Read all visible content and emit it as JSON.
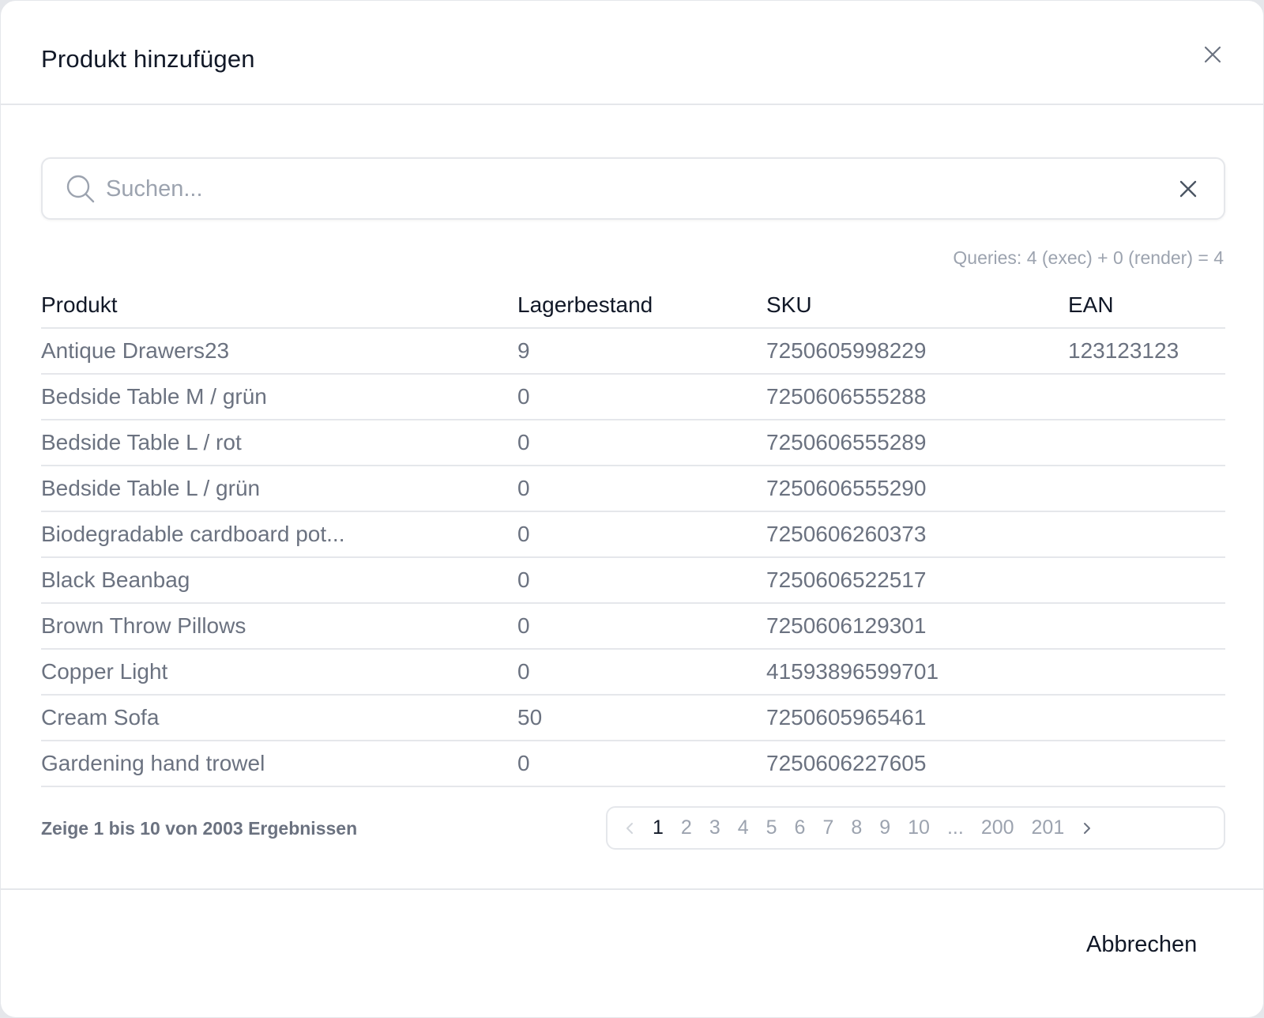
{
  "modal": {
    "title": "Produkt hinzufügen",
    "close_icon": "close-icon"
  },
  "search": {
    "placeholder": "Suchen...",
    "value": "",
    "icon": "search-icon",
    "clear_icon": "clear-icon"
  },
  "queries_text": "Queries: 4 (exec) + 0 (render) = 4",
  "table": {
    "headers": [
      "Produkt",
      "Lagerbestand",
      "SKU",
      "EAN"
    ],
    "rows": [
      {
        "product": "Antique Drawers23",
        "stock": "9",
        "sku": "7250605998229",
        "ean": "123123123"
      },
      {
        "product": "Bedside Table M / grün",
        "stock": "0",
        "sku": "7250606555288",
        "ean": ""
      },
      {
        "product": "Bedside Table L / rot",
        "stock": "0",
        "sku": "7250606555289",
        "ean": ""
      },
      {
        "product": "Bedside Table L / grün",
        "stock": "0",
        "sku": "7250606555290",
        "ean": ""
      },
      {
        "product": "Biodegradable cardboard pot...",
        "stock": "0",
        "sku": "7250606260373",
        "ean": ""
      },
      {
        "product": "Black Beanbag",
        "stock": "0",
        "sku": "7250606522517",
        "ean": ""
      },
      {
        "product": "Brown Throw Pillows",
        "stock": "0",
        "sku": "7250606129301",
        "ean": ""
      },
      {
        "product": "Copper Light",
        "stock": "0",
        "sku": "41593896599701",
        "ean": ""
      },
      {
        "product": "Cream Sofa",
        "stock": "50",
        "sku": "7250605965461",
        "ean": ""
      },
      {
        "product": "Gardening hand trowel",
        "stock": "0",
        "sku": "7250606227605",
        "ean": ""
      }
    ]
  },
  "summary": "Zeige 1 bis 10 von 2003 Ergebnissen",
  "pagination": {
    "prev_icon": "chevron-left-icon",
    "next_icon": "chevron-right-icon",
    "pages": [
      "1",
      "2",
      "3",
      "4",
      "5",
      "6",
      "7",
      "8",
      "9",
      "10"
    ],
    "ellipsis": "...",
    "last_pages": [
      "200",
      "201"
    ],
    "current": "1"
  },
  "footer": {
    "cancel_label": "Abbrechen"
  },
  "colors": {
    "text_primary": "#111827",
    "text_secondary": "#6b7280",
    "text_muted": "#9ca3af",
    "border": "#e5e7eb"
  }
}
